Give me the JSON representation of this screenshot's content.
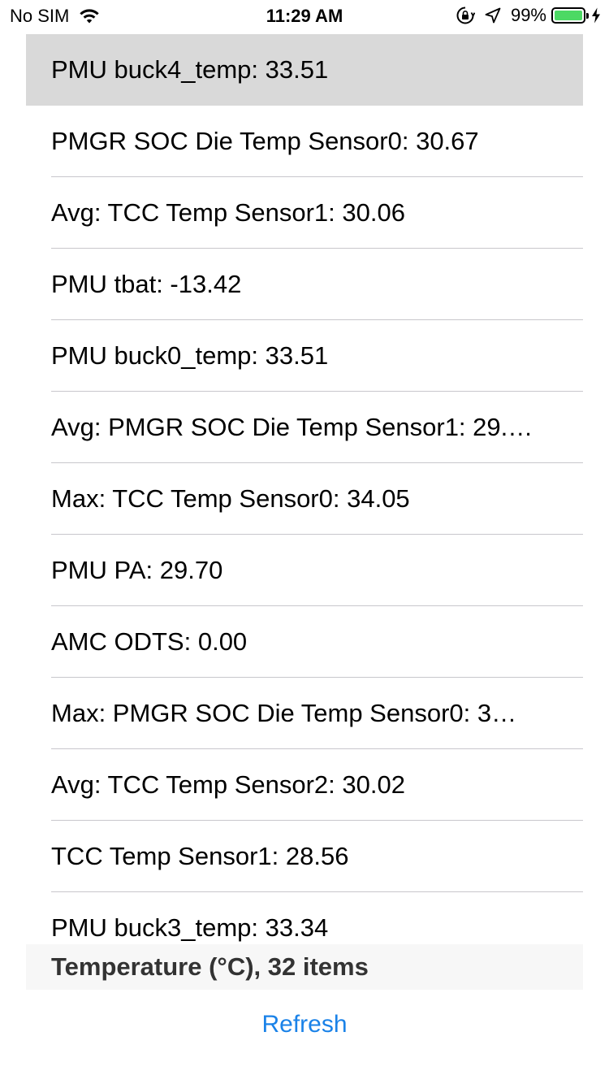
{
  "status_bar": {
    "carrier": "No SIM",
    "time": "11:29 AM",
    "battery_percent": "99%",
    "battery_level": 0.99,
    "battery_color": "#4cd964"
  },
  "list": {
    "selected_index": 0,
    "items": [
      "PMU buck4_temp: 33.51",
      "PMGR SOC Die Temp Sensor0: 30.67",
      "Avg: TCC Temp Sensor1: 30.06",
      "PMU tbat: -13.42",
      "PMU buck0_temp: 33.51",
      "Avg: PMGR SOC Die Temp Sensor1: 29.…",
      "Max: TCC Temp Sensor0: 34.05",
      "PMU PA: 29.70",
      "AMC ODTS: 0.00",
      "Max: PMGR SOC Die Temp Sensor0: 3…",
      "Avg: TCC Temp Sensor2: 30.02",
      "TCC Temp Sensor1: 28.56",
      "PMU buck3_temp: 33.34"
    ]
  },
  "section_footer": {
    "title": "Temperature (°C), 32 items"
  },
  "toolbar": {
    "refresh_label": "Refresh",
    "accent_color": "#1a82e8"
  }
}
